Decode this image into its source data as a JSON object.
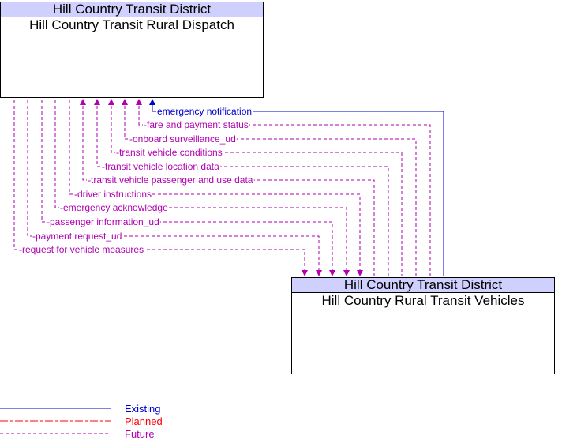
{
  "colors": {
    "existing": "#0000cc",
    "planned": "#ff0000",
    "future": "#b000b0",
    "header_fill": "#d0d0ff"
  },
  "source": {
    "org": "Hill Country Transit District",
    "name": "Hill Country Transit Rural Dispatch"
  },
  "target": {
    "org": "Hill Country Transit District",
    "name": "Hill Country Rural Transit Vehicles"
  },
  "flows": [
    {
      "label": "emergency notification",
      "status": "existing",
      "direction": "to-source"
    },
    {
      "label": "fare and payment status",
      "status": "future",
      "direction": "to-source"
    },
    {
      "label": "onboard surveillance_ud",
      "status": "future",
      "direction": "to-source"
    },
    {
      "label": "transit vehicle conditions",
      "status": "future",
      "direction": "to-source"
    },
    {
      "label": "transit vehicle location data",
      "status": "future",
      "direction": "to-source"
    },
    {
      "label": "transit vehicle passenger and use data",
      "status": "future",
      "direction": "to-source"
    },
    {
      "label": "driver instructions",
      "status": "future",
      "direction": "to-target"
    },
    {
      "label": "emergency acknowledge",
      "status": "future",
      "direction": "to-target"
    },
    {
      "label": "passenger information_ud",
      "status": "future",
      "direction": "to-target"
    },
    {
      "label": "payment request_ud",
      "status": "future",
      "direction": "to-target"
    },
    {
      "label": "request for vehicle measures",
      "status": "future",
      "direction": "to-target"
    }
  ],
  "legend": [
    {
      "label": "Existing",
      "status": "existing"
    },
    {
      "label": "Planned",
      "status": "planned"
    },
    {
      "label": "Future",
      "status": "future"
    }
  ]
}
